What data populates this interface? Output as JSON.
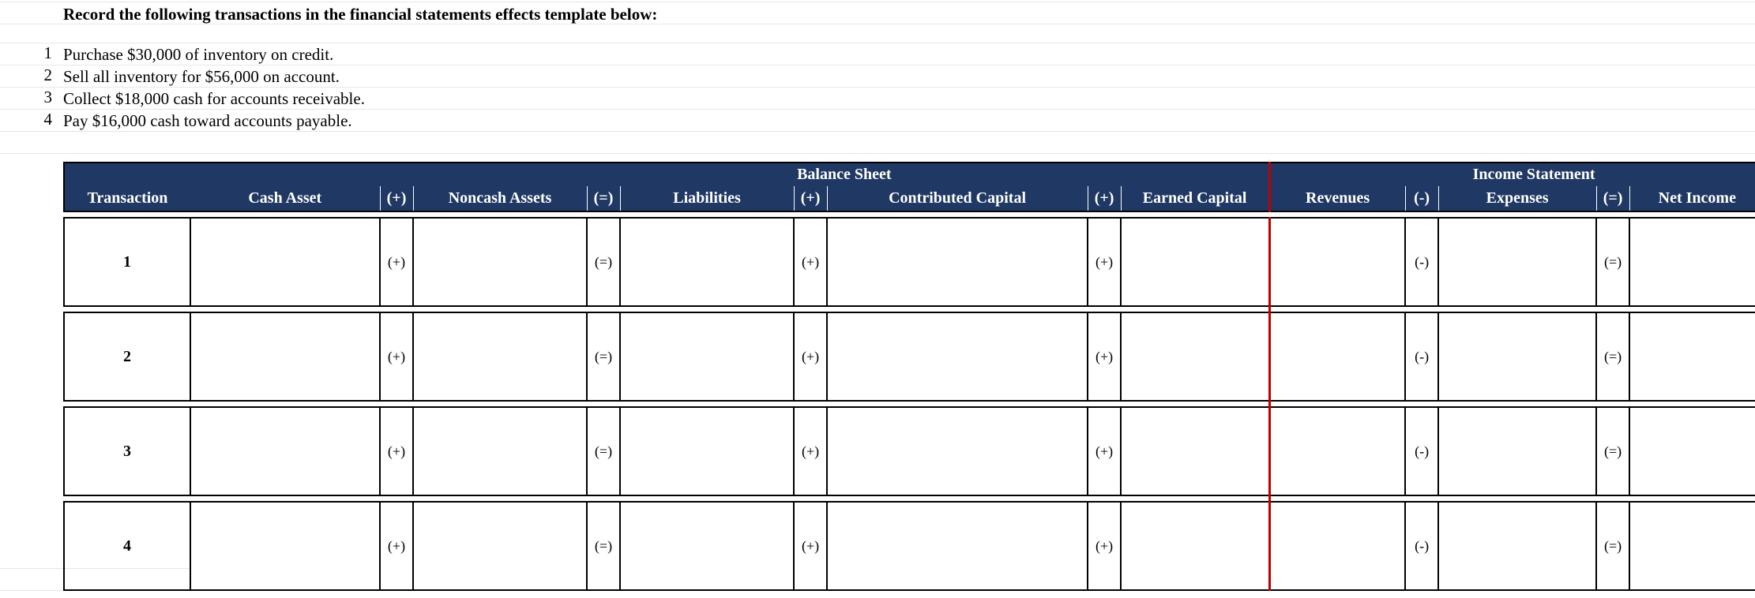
{
  "instruction": "Record the following transactions in the financial statements effects template below:",
  "transactions": [
    {
      "num": "1",
      "text": "Purchase $30,000 of inventory on credit."
    },
    {
      "num": "2",
      "text": "Sell all inventory for $56,000 on account."
    },
    {
      "num": "3",
      "text": "Collect $18,000 cash for accounts receivable."
    },
    {
      "num": "4",
      "text": "Pay $16,000 cash toward accounts payable."
    }
  ],
  "section_headers": {
    "balance_sheet": "Balance Sheet",
    "income_statement": "Income Statement"
  },
  "columns": {
    "transaction": "Transaction",
    "cash_asset": "Cash Asset",
    "noncash_assets": "Noncash Assets",
    "liabilities": "Liabilities",
    "contributed_capital": "Contributed Capital",
    "earned_capital": "Earned Capital",
    "revenues": "Revenues",
    "expenses": "Expenses",
    "net_income": "Net Income"
  },
  "ops": {
    "plus": "(+)",
    "equals": "(=)",
    "minus": "(-)"
  },
  "row_labels": [
    "1",
    "2",
    "3",
    "4"
  ]
}
